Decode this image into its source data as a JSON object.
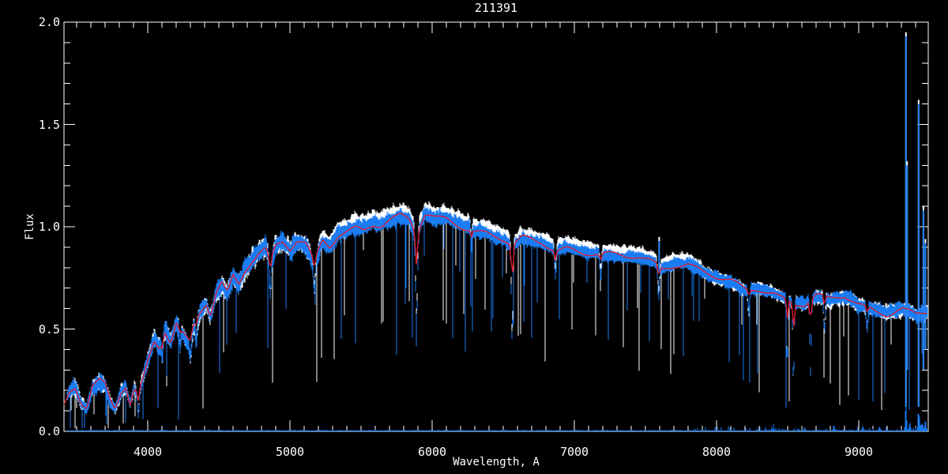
{
  "title": "211391",
  "colors": {
    "background": "#000000",
    "axis": "#ffffff",
    "observed": "#1b7cf2",
    "overlay": "#ffffff",
    "model": "#e8192c",
    "sky": "#1b7cf2"
  },
  "chart_data": {
    "type": "line",
    "title": "211391",
    "xlabel": "Wavelength, A",
    "ylabel": "Flux",
    "xlim": [
      3410,
      9490
    ],
    "ylim": [
      0.0,
      2.0
    ],
    "xticks": [
      4000,
      5000,
      6000,
      7000,
      8000,
      9000
    ],
    "xtick_labels": [
      "4000",
      "5000",
      "6000",
      "7000",
      "8000",
      "9000"
    ],
    "yticks": [
      0.0,
      0.5,
      1.0,
      1.5,
      2.0
    ],
    "ytick_labels": [
      "0.0",
      "0.5",
      "1.0",
      "1.5",
      "2.0"
    ],
    "minor_x_step": 100,
    "minor_y_step": 0.1,
    "grid": false,
    "legend": "none",
    "series": [
      {
        "name": "overlay-spectrum",
        "color": "#ffffff",
        "role": "noisy comparison spectrum drawn behind"
      },
      {
        "name": "observed-spectrum",
        "color": "#1b7cf2",
        "role": "noisy observed spectrum"
      },
      {
        "name": "model-fit",
        "color": "#e8192c",
        "role": "smooth template fit"
      },
      {
        "name": "sky-residual",
        "color": "#1b7cf2",
        "role": "near-zero sky/error trace"
      }
    ],
    "continuum": [
      [
        3410,
        0.13
      ],
      [
        3450,
        0.2
      ],
      [
        3490,
        0.22
      ],
      [
        3530,
        0.14
      ],
      [
        3570,
        0.11
      ],
      [
        3610,
        0.21
      ],
      [
        3660,
        0.24
      ],
      [
        3700,
        0.22
      ],
      [
        3740,
        0.14
      ],
      [
        3770,
        0.11
      ],
      [
        3810,
        0.19
      ],
      [
        3845,
        0.22
      ],
      [
        3875,
        0.13
      ],
      [
        3905,
        0.21
      ],
      [
        3933,
        0.18
      ],
      [
        3970,
        0.27
      ],
      [
        4005,
        0.36
      ],
      [
        4045,
        0.45
      ],
      [
        4080,
        0.42
      ],
      [
        4120,
        0.5
      ],
      [
        4160,
        0.44
      ],
      [
        4200,
        0.53
      ],
      [
        4240,
        0.48
      ],
      [
        4285,
        0.44
      ],
      [
        4330,
        0.53
      ],
      [
        4370,
        0.58
      ],
      [
        4410,
        0.62
      ],
      [
        4440,
        0.56
      ],
      [
        4480,
        0.67
      ],
      [
        4520,
        0.72
      ],
      [
        4560,
        0.67
      ],
      [
        4600,
        0.76
      ],
      [
        4640,
        0.72
      ],
      [
        4680,
        0.79
      ],
      [
        4730,
        0.84
      ],
      [
        4780,
        0.88
      ],
      [
        4830,
        0.9
      ],
      [
        4861,
        0.83
      ],
      [
        4900,
        0.91
      ],
      [
        4950,
        0.93
      ],
      [
        5000,
        0.89
      ],
      [
        5050,
        0.93
      ],
      [
        5110,
        0.91
      ],
      [
        5170,
        0.82
      ],
      [
        5230,
        0.93
      ],
      [
        5280,
        0.9
      ],
      [
        5340,
        0.96
      ],
      [
        5400,
        0.98
      ],
      [
        5460,
        1.0
      ],
      [
        5520,
        0.99
      ],
      [
        5580,
        1.02
      ],
      [
        5640,
        1.01
      ],
      [
        5700,
        1.03
      ],
      [
        5780,
        1.05
      ],
      [
        5840,
        1.03
      ],
      [
        5890,
        0.96
      ],
      [
        5950,
        1.06
      ],
      [
        6020,
        1.04
      ],
      [
        6100,
        1.04
      ],
      [
        6170,
        1.02
      ],
      [
        6240,
        1.0
      ],
      [
        6310,
        0.98
      ],
      [
        6380,
        0.97
      ],
      [
        6450,
        0.95
      ],
      [
        6520,
        0.93
      ],
      [
        6563,
        0.9
      ],
      [
        6630,
        0.94
      ],
      [
        6700,
        0.93
      ],
      [
        6780,
        0.92
      ],
      [
        6867,
        0.89
      ],
      [
        6950,
        0.9
      ],
      [
        7050,
        0.88
      ],
      [
        7150,
        0.87
      ],
      [
        7250,
        0.86
      ],
      [
        7350,
        0.85
      ],
      [
        7450,
        0.85
      ],
      [
        7550,
        0.83
      ],
      [
        7620,
        0.8
      ],
      [
        7700,
        0.82
      ],
      [
        7800,
        0.82
      ],
      [
        7900,
        0.78
      ],
      [
        8000,
        0.75
      ],
      [
        8100,
        0.73
      ],
      [
        8200,
        0.69
      ],
      [
        8300,
        0.7
      ],
      [
        8400,
        0.68
      ],
      [
        8480,
        0.65
      ],
      [
        8550,
        0.63
      ],
      [
        8620,
        0.62
      ],
      [
        8700,
        0.66
      ],
      [
        8800,
        0.64
      ],
      [
        8900,
        0.66
      ],
      [
        9000,
        0.62
      ],
      [
        9100,
        0.6
      ],
      [
        9200,
        0.58
      ],
      [
        9300,
        0.6
      ],
      [
        9400,
        0.57
      ],
      [
        9490,
        0.58
      ]
    ],
    "absorption_lines": [
      [
        3933,
        0.1,
        7
      ],
      [
        4101,
        0.1,
        6
      ],
      [
        4227,
        0.08,
        5
      ],
      [
        4300,
        0.1,
        8
      ],
      [
        4340,
        0.1,
        6
      ],
      [
        4861,
        0.15,
        6
      ],
      [
        5172,
        0.12,
        8
      ],
      [
        5890,
        0.42,
        7
      ],
      [
        6277,
        0.08,
        5
      ],
      [
        6563,
        0.45,
        6
      ],
      [
        6867,
        0.12,
        6
      ],
      [
        7186,
        0.1,
        6
      ],
      [
        7594,
        0.15,
        7
      ],
      [
        8228,
        0.1,
        6
      ],
      [
        8498,
        0.3,
        5
      ],
      [
        8542,
        0.38,
        5
      ],
      [
        8662,
        0.35,
        5
      ],
      [
        8760,
        0.15,
        6
      ],
      [
        9060,
        0.1,
        6
      ]
    ],
    "emission_spikes": [
      [
        7597,
        0.93,
        0.78
      ],
      [
        9333,
        1.93,
        0.12
      ],
      [
        9341,
        1.3,
        0.3
      ],
      [
        9422,
        1.6,
        0.12
      ],
      [
        9456,
        1.08,
        0.3
      ],
      [
        9470,
        0.92,
        0.4
      ]
    ],
    "noise_profile": [
      [
        3410,
        0.38
      ],
      [
        3700,
        0.35
      ],
      [
        3900,
        0.25
      ],
      [
        4200,
        0.17
      ],
      [
        4600,
        0.14
      ],
      [
        5000,
        0.1
      ],
      [
        5400,
        0.08
      ],
      [
        6000,
        0.07
      ],
      [
        6600,
        0.06
      ],
      [
        7200,
        0.06
      ],
      [
        7800,
        0.07
      ],
      [
        8300,
        0.08
      ],
      [
        8700,
        0.09
      ],
      [
        9100,
        0.11
      ],
      [
        9300,
        0.13
      ],
      [
        9490,
        0.14
      ]
    ],
    "sky": {
      "level": 0.004,
      "spikes": [
        [
          8400,
          0.012
        ],
        [
          8620,
          0.015
        ],
        [
          8827,
          0.02
        ],
        [
          9030,
          0.025
        ],
        [
          9150,
          0.02
        ],
        [
          9333,
          0.11
        ],
        [
          9360,
          0.05
        ],
        [
          9422,
          0.09
        ],
        [
          9445,
          0.05
        ],
        [
          9470,
          0.07
        ]
      ]
    }
  }
}
